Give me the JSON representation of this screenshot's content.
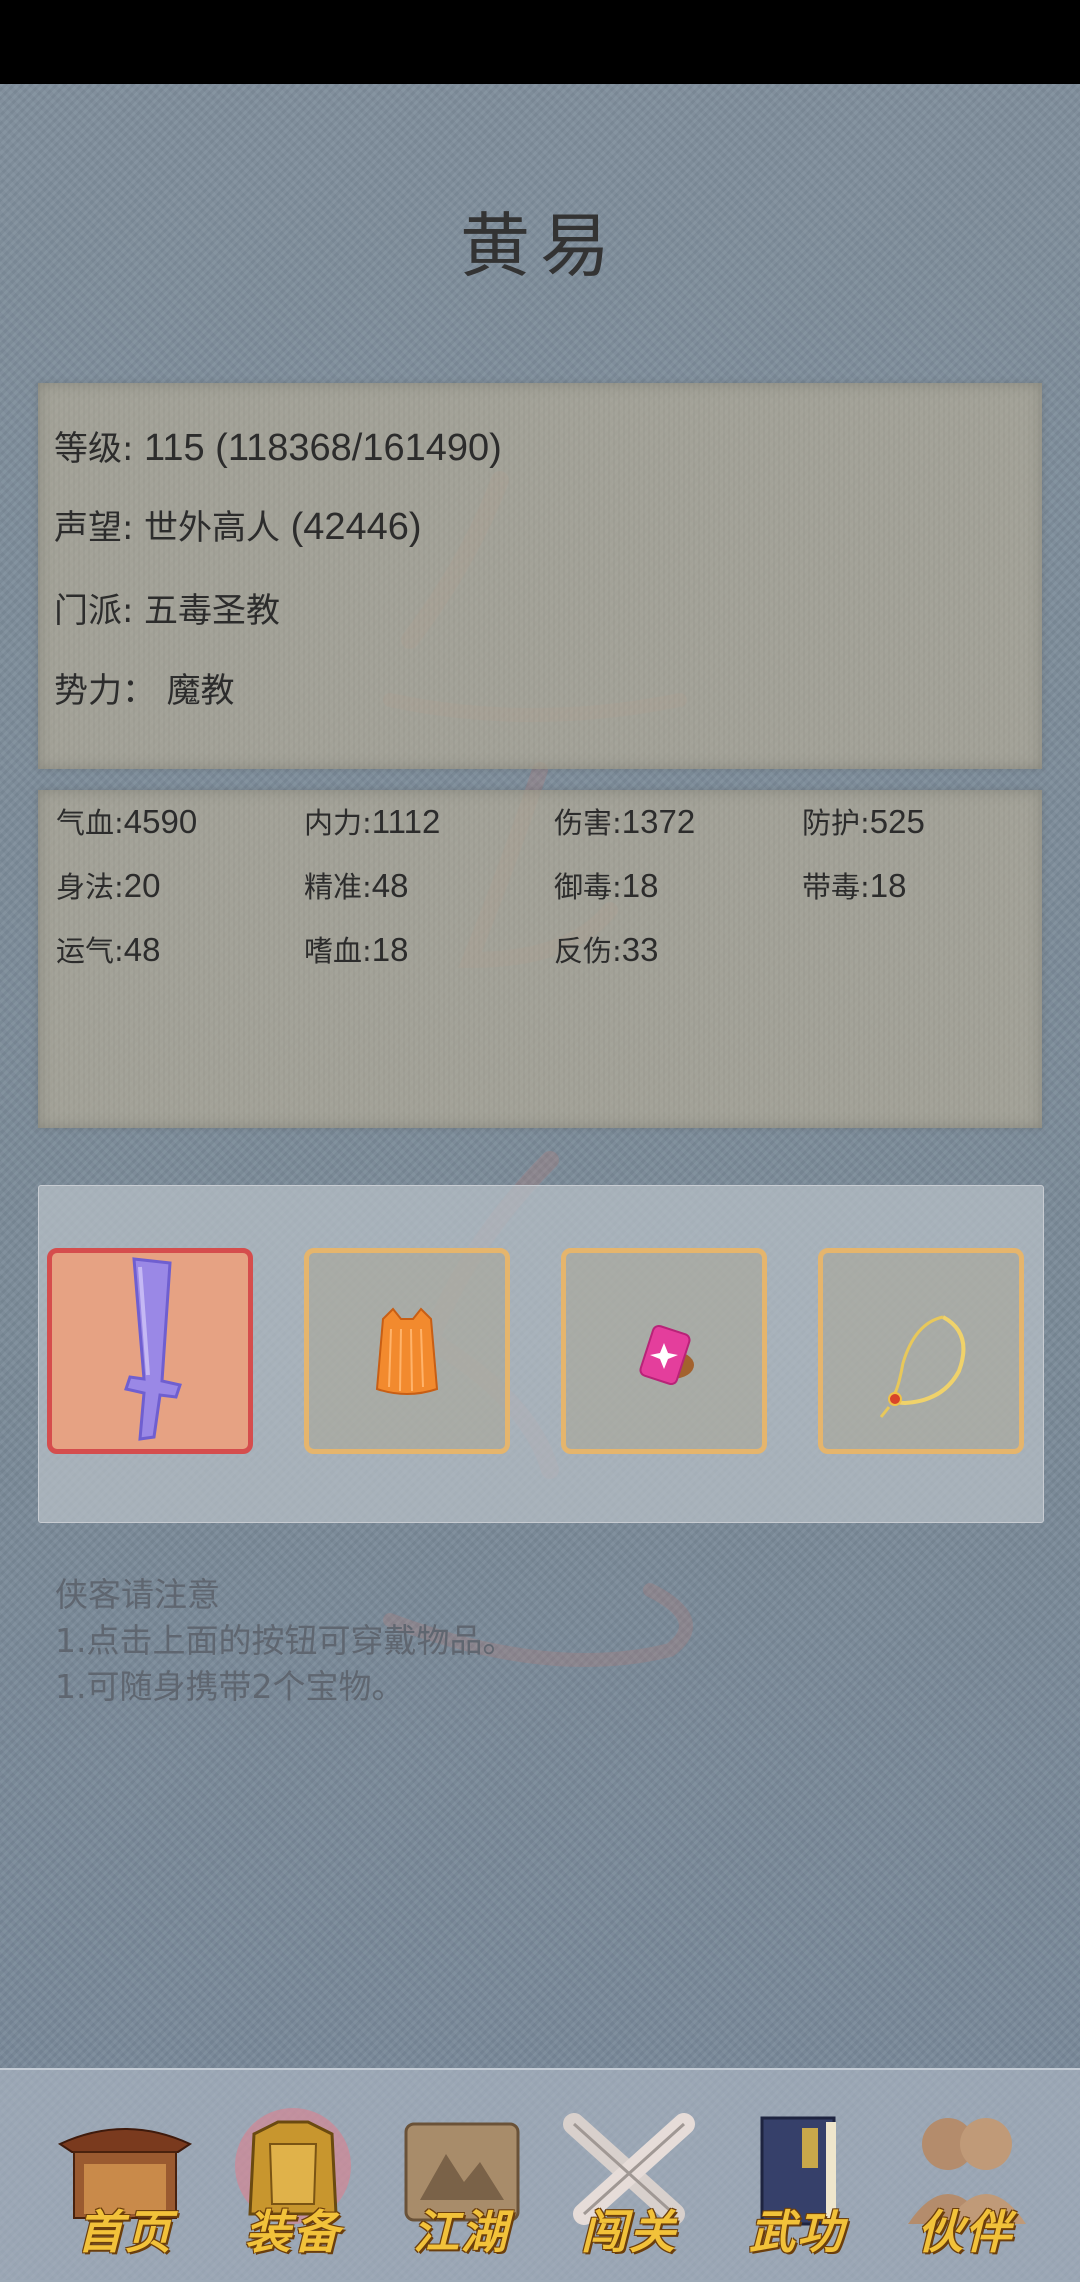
{
  "header": {
    "title": "黄易"
  },
  "info": {
    "level_label": "等级:",
    "level_value": "115 (118368/161490)",
    "fame_label": "声望:",
    "fame_title": "世外高人",
    "fame_value": "(42446)",
    "sect_label": "门派:",
    "sect_value": "五毒圣教",
    "faction_label": "势力：",
    "faction_value": "魔教"
  },
  "stats": [
    {
      "label": "气血:",
      "value": "4590"
    },
    {
      "label": "内力:",
      "value": "1112"
    },
    {
      "label": "伤害:",
      "value": "1372"
    },
    {
      "label": "防护:",
      "value": "525"
    },
    {
      "label": "身法:",
      "value": "20"
    },
    {
      "label": "精准:",
      "value": "48"
    },
    {
      "label": "御毒:",
      "value": "18"
    },
    {
      "label": "带毒:",
      "value": "18"
    },
    {
      "label": "运气:",
      "value": "48"
    },
    {
      "label": "嗜血:",
      "value": "18"
    },
    {
      "label": "反伤:",
      "value": "33"
    }
  ],
  "equipment": [
    {
      "icon": "sword-icon",
      "active": true
    },
    {
      "icon": "armor-icon",
      "active": false
    },
    {
      "icon": "gem-icon",
      "active": false
    },
    {
      "icon": "necklace-icon",
      "active": false
    }
  ],
  "notes": {
    "heading": "侠客请注意",
    "line1": "1.点击上面的按钮可穿戴物品。",
    "line2": "1.可随身携带2个宝物。"
  },
  "nav": [
    {
      "label": "首页",
      "icon": "temple-icon"
    },
    {
      "label": "装备",
      "icon": "armor-icon"
    },
    {
      "label": "江湖",
      "icon": "scroll-map-icon"
    },
    {
      "label": "闯关",
      "icon": "crossed-swords-icon"
    },
    {
      "label": "武功",
      "icon": "book-icon"
    },
    {
      "label": "伙伴",
      "icon": "companions-icon"
    }
  ],
  "colors": {
    "accent_gold": "#f2c23a",
    "slot_border": "#e5b56d",
    "slot_active_border": "#d54d4d",
    "slot_active_bg": "#e6a283"
  }
}
